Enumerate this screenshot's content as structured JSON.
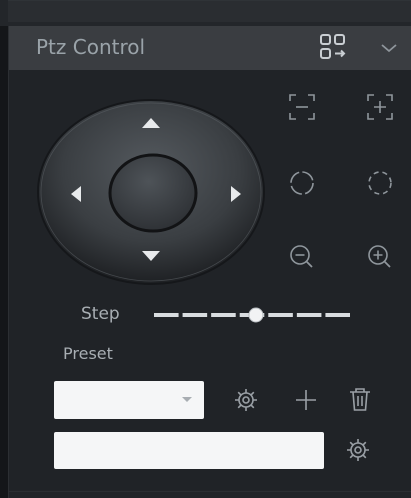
{
  "panel": {
    "title": "Ptz Control"
  },
  "header_icons": [
    "layout-switch-icon",
    "chevron-down-icon"
  ],
  "joystick": {
    "buttons": [
      "arrow-up",
      "arrow-down",
      "arrow-left",
      "arrow-right",
      "center-stick"
    ]
  },
  "controls": {
    "zoom_out_frame": "zoom-frame-out-icon",
    "zoom_in_frame": "zoom-frame-in-icon",
    "focus_near": "focus-near-icon",
    "focus_far": "focus-far-icon",
    "zoom_minus": "zoom-out-icon",
    "zoom_plus": "zoom-in-icon"
  },
  "step": {
    "label": "Step",
    "segments": 7,
    "value_fraction": 0.52
  },
  "preset": {
    "label": "Preset",
    "select_value": "",
    "input_value": ""
  },
  "colors": {
    "panel_bg": "#202327",
    "header_bg": "#3a3d41",
    "icon": "#9aa0a6",
    "text": "#a8aeb3",
    "field_bg": "#f5f6f7"
  }
}
